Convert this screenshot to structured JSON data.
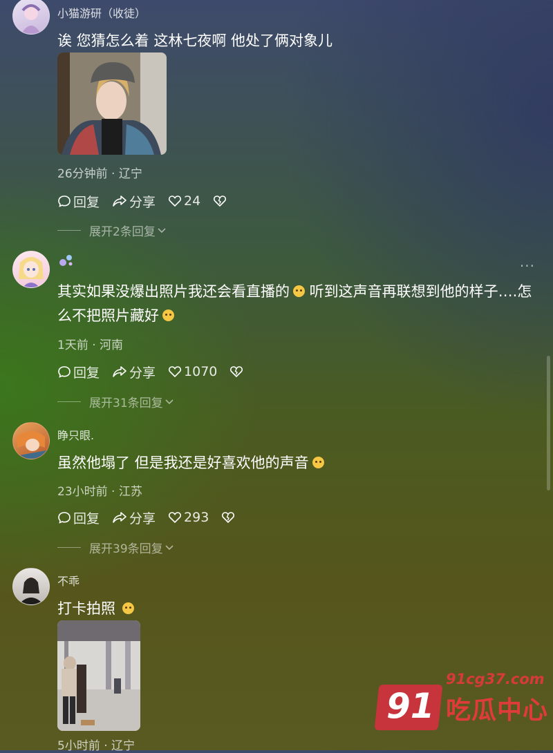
{
  "comments": [
    {
      "username": "小猫游研（收徒）",
      "text": "诶 您猜怎么着 这林七夜啊 他处了俩对象儿",
      "meta": "26分钟前 · 辽宁",
      "reply_label": "回复",
      "share_label": "分享",
      "likes": "24",
      "replies_label": "展开2条回复"
    },
    {
      "username": "",
      "text_part1": "其实如果没爆出照片我还会看直播的",
      "text_part2": " 听到这声音再联想到他的样子….怎么不把照片藏好",
      "meta": "1天前 · 河南",
      "reply_label": "回复",
      "share_label": "分享",
      "likes": "1070",
      "replies_label": "展开31条回复",
      "more_label": "···"
    },
    {
      "username": "睁只眼.",
      "text": "虽然他塌了 但是我还是好喜欢他的声音",
      "meta": "23小时前 · 江苏",
      "reply_label": "回复",
      "share_label": "分享",
      "likes": "293",
      "replies_label": "展开39条回复"
    },
    {
      "username": "不乖",
      "text": "打卡拍照",
      "meta": "5小时前 · 辽宁"
    }
  ],
  "watermark": {
    "number": "91",
    "url": "91cg37.com",
    "name": "吃瓜中心"
  }
}
